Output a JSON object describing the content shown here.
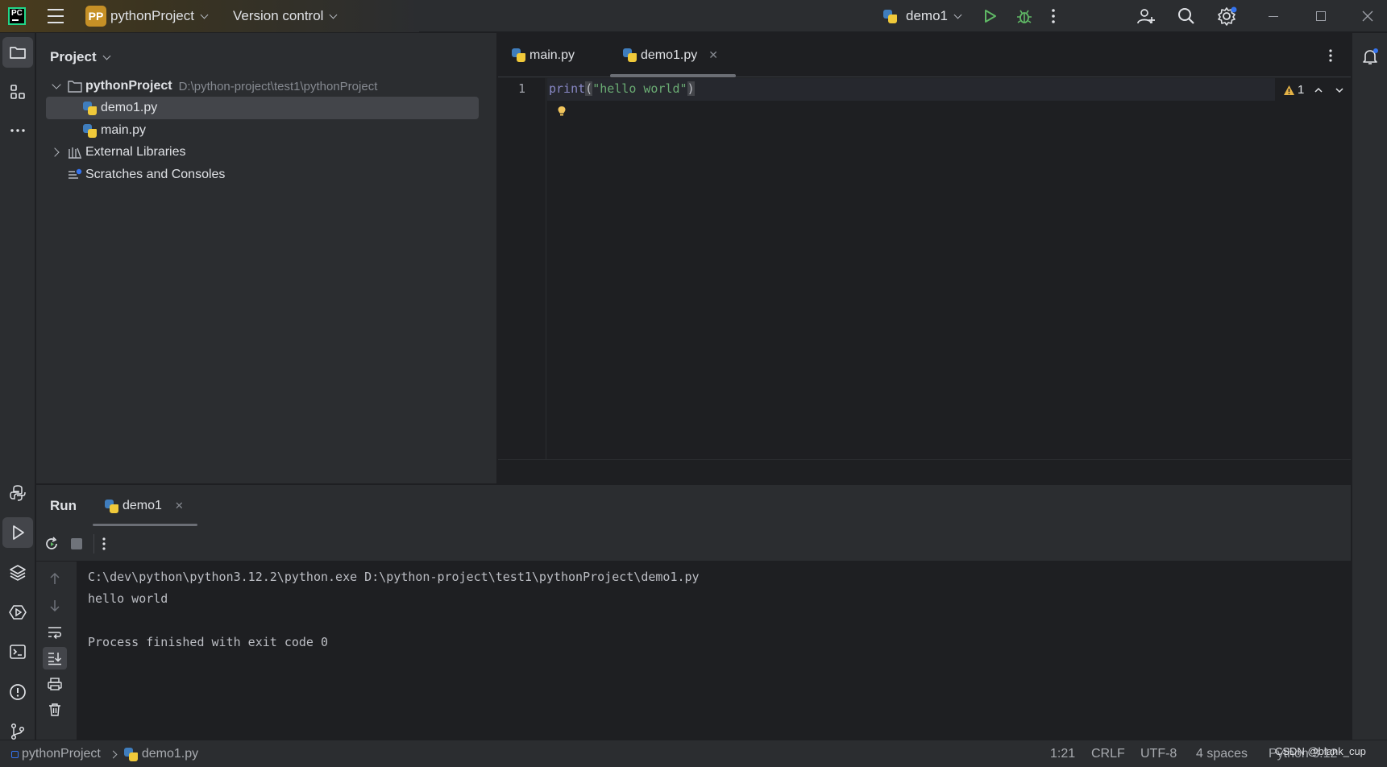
{
  "colors": {
    "accent_run": "#5fb865",
    "project_badge": "#c69026",
    "editor_bg": "#1e1f22",
    "panel_bg": "#2b2d30",
    "string": "#6aab73",
    "keyword": "#8888c6"
  },
  "titlebar": {
    "project_badge": "PP",
    "project_name": "pythonProject",
    "vcs_label": "Version control",
    "run_config": "demo1"
  },
  "project_pane": {
    "header": "Project",
    "tree": [
      {
        "label": "pythonProject",
        "path": "D:\\python-project\\test1\\pythonProject"
      },
      {
        "label": "demo1.py"
      },
      {
        "label": "main.py"
      },
      {
        "label": "External Libraries"
      },
      {
        "label": "Scratches and Consoles"
      }
    ]
  },
  "editor": {
    "tabs": [
      {
        "label": "main.py"
      },
      {
        "label": "demo1.py"
      }
    ],
    "line_number": "1",
    "code": {
      "func": "print",
      "open": "(",
      "string": "\"hello world\"",
      "close": ")"
    },
    "warning_count": "1"
  },
  "run": {
    "title": "Run",
    "tab_label": "demo1",
    "console": [
      "C:\\dev\\python\\python3.12.2\\python.exe D:\\python-project\\test1\\pythonProject\\demo1.py",
      "hello world",
      "",
      "Process finished with exit code 0"
    ]
  },
  "statusbar": {
    "breadcrumb_project": "pythonProject",
    "breadcrumb_file": "demo1.py",
    "position": "1:21",
    "line_sep": "CRLF",
    "encoding": "UTF-8",
    "indent": "4 spaces",
    "interpreter": "Python 3.12",
    "watermark": "CSDN @blank_cup"
  }
}
